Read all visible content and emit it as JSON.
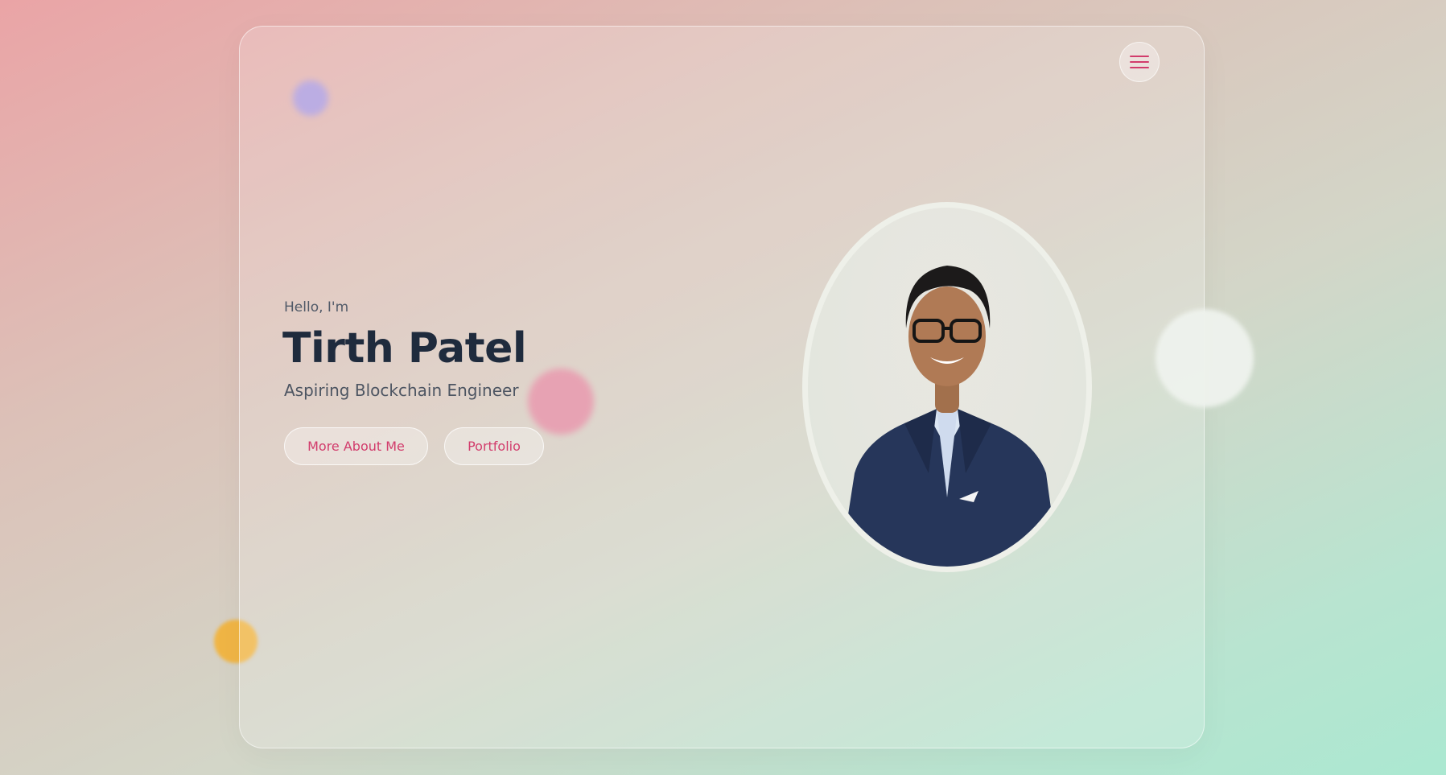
{
  "hero": {
    "greeting": "Hello, I'm",
    "name": "Tirth Patel",
    "subtitle": "Aspiring Blockchain Engineer"
  },
  "buttons": {
    "more_about_me": "More About Me",
    "portfolio": "Portfolio"
  },
  "nav": {
    "menu_icon": "hamburger-menu-icon"
  },
  "portrait": {
    "icon": "profile-photo"
  },
  "colors": {
    "accent": "#d23c6c",
    "heading": "#1f2b3d",
    "text": "#4d5562",
    "blob_purple": "#a899e2",
    "blob_pink": "#e99aaf",
    "blob_orange": "#f0b545",
    "blob_white": "#eff3ee"
  }
}
